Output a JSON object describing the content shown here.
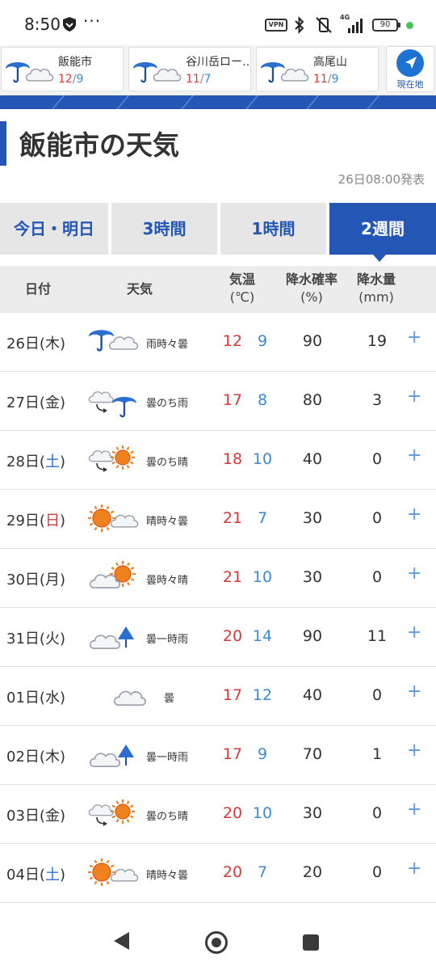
{
  "status_bar": {
    "time": "8:50",
    "dots": "···",
    "vpn": "VPN",
    "network": "4G",
    "battery": "90"
  },
  "locations": [
    {
      "name": "飯能市",
      "hi": "12",
      "lo": "9",
      "icon": "rain-then-cloudy-icon"
    },
    {
      "name": "谷川岳ロー…",
      "hi": "11",
      "lo": "7",
      "icon": "rain-then-cloudy-icon"
    },
    {
      "name": "高尾山",
      "hi": "11",
      "lo": "9",
      "icon": "rain-then-cloudy-icon"
    }
  ],
  "current_location": {
    "label": "現在地"
  },
  "page": {
    "title": "飯能市の天気",
    "published": "26日08:00発表"
  },
  "tabs": [
    {
      "label": "今日・明日",
      "active": false
    },
    {
      "label": "3時間",
      "active": false
    },
    {
      "label": "1時間",
      "active": false
    },
    {
      "label": "2週間",
      "active": true
    }
  ],
  "table_header": {
    "date": "日付",
    "weather": "天気",
    "temp_line1": "気温",
    "temp_line2": "(℃)",
    "pop_line1": "降水確率",
    "pop_line2": "(%)",
    "amount_line1": "降水量",
    "amount_line2": "(mm)"
  },
  "rows": [
    {
      "day": "26日",
      "dow_open": "(",
      "dow": "木",
      "dow_close": ")",
      "dow_type": "weekday",
      "icon": "rain-sometimes-cloudy-icon",
      "desc": "雨時々曇",
      "hi": "12",
      "lo": "9",
      "pop": "90",
      "amount": "19",
      "plus": "+"
    },
    {
      "day": "27日",
      "dow_open": "(",
      "dow": "金",
      "dow_close": ")",
      "dow_type": "weekday",
      "icon": "cloudy-then-rain-icon",
      "desc": "曇のち雨",
      "hi": "17",
      "lo": "8",
      "pop": "80",
      "amount": "3",
      "plus": "+"
    },
    {
      "day": "28日",
      "dow_open": "(",
      "dow": "土",
      "dow_close": ")",
      "dow_type": "sat",
      "icon": "cloudy-then-sunny-icon",
      "desc": "曇のち晴",
      "hi": "18",
      "lo": "10",
      "pop": "40",
      "amount": "0",
      "plus": "+"
    },
    {
      "day": "29日",
      "dow_open": "(",
      "dow": "日",
      "dow_close": ")",
      "dow_type": "sun",
      "icon": "sunny-sometimes-cloudy-icon",
      "desc": "晴時々曇",
      "hi": "21",
      "lo": "7",
      "pop": "30",
      "amount": "0",
      "plus": "+"
    },
    {
      "day": "30日",
      "dow_open": "(",
      "dow": "月",
      "dow_close": ")",
      "dow_type": "weekday",
      "icon": "cloudy-sometimes-sunny-icon",
      "desc": "曇時々晴",
      "hi": "21",
      "lo": "10",
      "pop": "30",
      "amount": "0",
      "plus": "+"
    },
    {
      "day": "31日",
      "dow_open": "(",
      "dow": "火",
      "dow_close": ")",
      "dow_type": "weekday",
      "icon": "cloudy-temporary-rain-icon",
      "desc": "曇一時雨",
      "hi": "20",
      "lo": "14",
      "pop": "90",
      "amount": "11",
      "plus": "+"
    },
    {
      "day": "01日",
      "dow_open": "(",
      "dow": "水",
      "dow_close": ")",
      "dow_type": "weekday",
      "icon": "cloudy-icon",
      "desc": "曇",
      "hi": "17",
      "lo": "12",
      "pop": "40",
      "amount": "0",
      "plus": "+"
    },
    {
      "day": "02日",
      "dow_open": "(",
      "dow": "木",
      "dow_close": ")",
      "dow_type": "weekday",
      "icon": "cloudy-temporary-rain-icon",
      "desc": "曇一時雨",
      "hi": "17",
      "lo": "9",
      "pop": "70",
      "amount": "1",
      "plus": "+"
    },
    {
      "day": "03日",
      "dow_open": "(",
      "dow": "金",
      "dow_close": ")",
      "dow_type": "weekday",
      "icon": "cloudy-then-sunny-icon",
      "desc": "曇のち晴",
      "hi": "20",
      "lo": "10",
      "pop": "30",
      "amount": "0",
      "plus": "+"
    },
    {
      "day": "04日",
      "dow_open": "(",
      "dow": "土",
      "dow_close": ")",
      "dow_type": "sat",
      "icon": "sunny-sometimes-cloudy-icon",
      "desc": "晴時々曇",
      "hi": "20",
      "lo": "7",
      "pop": "20",
      "amount": "0",
      "plus": "+"
    }
  ],
  "colors": {
    "accent": "#2456b5",
    "high_temp": "#d9383a",
    "low_temp": "#3b8ad8",
    "tab_bg": "#e6e6e6",
    "plus": "#5b9ae0"
  }
}
